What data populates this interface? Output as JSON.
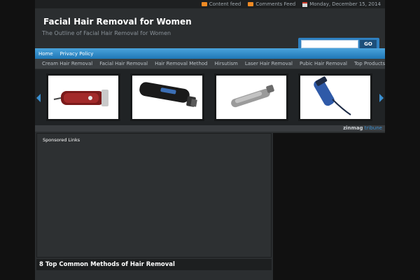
{
  "topbar": {
    "content_feed": "Content feed",
    "comments_feed": "Comments Feed",
    "date": "Monday, December 15, 2014"
  },
  "header": {
    "title": "Facial Hair Removal for Women",
    "tagline": "The Outline of Facial Hair Removal for Women"
  },
  "search": {
    "value": "",
    "button_label": "GO"
  },
  "nav": {
    "items": [
      {
        "label": "Home"
      },
      {
        "label": "Privacy Policy"
      }
    ]
  },
  "categories": {
    "items": [
      {
        "label": "Cream Hair Removal"
      },
      {
        "label": "Facial Hair Removal"
      },
      {
        "label": "Hair Removal Method"
      },
      {
        "label": "Hirsutism"
      },
      {
        "label": "Laser Hair Removal"
      },
      {
        "label": "Pubic Hair Removal"
      },
      {
        "label": "Top Products"
      }
    ]
  },
  "slider": {
    "items": [
      {
        "icon": "red-clipper-image"
      },
      {
        "icon": "black-trimmer-image"
      },
      {
        "icon": "silver-trimmer-image"
      },
      {
        "icon": "blue-clipper-image"
      }
    ]
  },
  "brand": {
    "name": "zinmag",
    "suffix": "tribune"
  },
  "content": {
    "sponsored_label": "Sponsored Links",
    "post_title": "8 Top Common Methods of Hair Removal"
  },
  "colors": {
    "accent": "#2f80c0",
    "background": "#111111",
    "panel": "#2b2e30"
  }
}
